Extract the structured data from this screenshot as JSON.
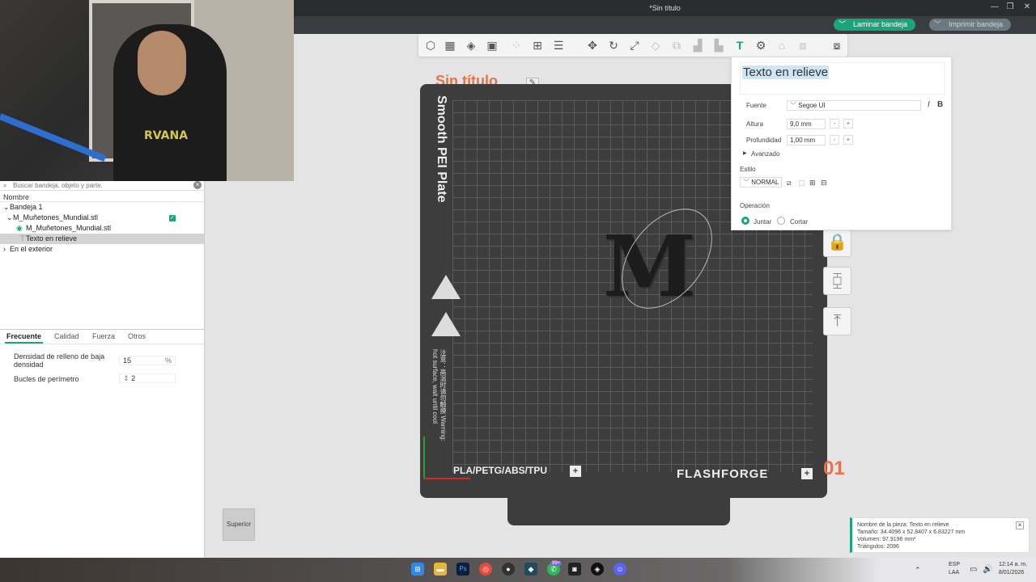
{
  "window": {
    "title": "*Sin título",
    "minimize": "—",
    "maximize": "❐",
    "close": "✕"
  },
  "header": {
    "slice_label": "Laminar bandeja",
    "print_label": "Imprimir bandeja"
  },
  "search": {
    "placeholder": "Buscar bandeja, objeto y parte."
  },
  "tree": {
    "header": "Nombre",
    "items": [
      {
        "label": "Bandeja 1"
      },
      {
        "label": "M_Muñetones_Mundial.stl"
      },
      {
        "label": "M_Muñetones_Mundial.stl"
      },
      {
        "label": "Texto en relieve"
      },
      {
        "label": "En el exterior"
      }
    ]
  },
  "tabs": [
    "Frecuente",
    "Calidad",
    "Fuerza",
    "Otros"
  ],
  "params": {
    "infill_label": "Densidad de relleno de baja densidad",
    "infill_value": "15",
    "infill_unit": "%",
    "perimeter_label": "Bucles de perímetro",
    "perimeter_value": "2"
  },
  "plate": {
    "name": "Sin título",
    "vertical_text": "Smooth PEI Plate",
    "warning_text": "注意：高温时请勿触摸 Warning: hot surface, wait until cool",
    "material": "PLA/PETG/ABS/TPU",
    "brand": "FLASHFORGE",
    "number": "01",
    "model_letter": "M"
  },
  "text_panel": {
    "text": "Texto en relieve",
    "font_label": "Fuente",
    "font_value": "Segoe UI",
    "italic": "I",
    "bold": "B",
    "height_label": "Altura",
    "height_value": "9,0 mm",
    "depth_label": "Profundidad",
    "depth_value": "1,00 mm",
    "advanced_label": "Avanzado",
    "style_label": "Estilo",
    "style_value": "NORMAL",
    "operation_label": "Operación",
    "op_join": "Juntar",
    "op_cut": "Cortar"
  },
  "gizmo": {
    "label": "Superior"
  },
  "notice": {
    "name": "Nombre de la pieza: Texto en relieve",
    "size": "Tamaño: 34.4096 x 52.8407 x 6.83227 mm",
    "volume": "Volumen: 97.9196 mm³",
    "triangles": "Triángulos: 2096"
  },
  "taskbar": {
    "lang": "ESP",
    "lang2": "LAA",
    "time": "12:14 a. m.",
    "date": "8/01/2026",
    "badge": "99+"
  },
  "colors": {
    "accent": "#1ba37a",
    "plate_name": "#e8734a"
  }
}
